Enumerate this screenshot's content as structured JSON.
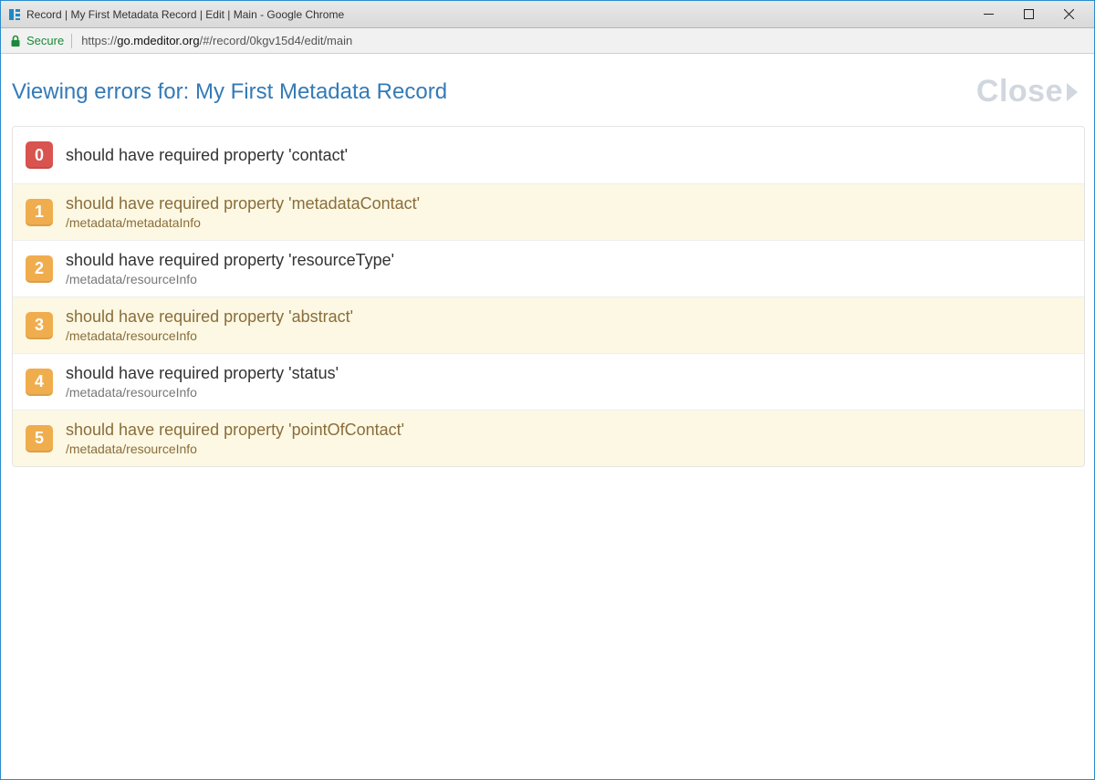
{
  "window": {
    "title": "Record | My First Metadata Record | Edit | Main - Google Chrome"
  },
  "addressbar": {
    "secure_label": "Secure",
    "url_prefix": "https://",
    "url_host": "go.mdeditor.org",
    "url_path": "/#/record/0kgv15d4/edit/main"
  },
  "header": {
    "title_prefix": "Viewing errors for: ",
    "record_name": "My First Metadata Record",
    "close_label": "Close"
  },
  "errors": [
    {
      "index": "0",
      "badge_color": "red",
      "striped": false,
      "message": "should have required property 'contact'",
      "path": ""
    },
    {
      "index": "1",
      "badge_color": "orange",
      "striped": true,
      "message": "should have required property 'metadataContact'",
      "path": "/metadata/metadataInfo"
    },
    {
      "index": "2",
      "badge_color": "orange",
      "striped": false,
      "message": "should have required property 'resourceType'",
      "path": "/metadata/resourceInfo"
    },
    {
      "index": "3",
      "badge_color": "orange",
      "striped": true,
      "message": "should have required property 'abstract'",
      "path": "/metadata/resourceInfo"
    },
    {
      "index": "4",
      "badge_color": "orange",
      "striped": false,
      "message": "should have required property 'status'",
      "path": "/metadata/resourceInfo"
    },
    {
      "index": "5",
      "badge_color": "orange",
      "striped": true,
      "message": "should have required property 'pointOfContact'",
      "path": "/metadata/resourceInfo"
    }
  ]
}
